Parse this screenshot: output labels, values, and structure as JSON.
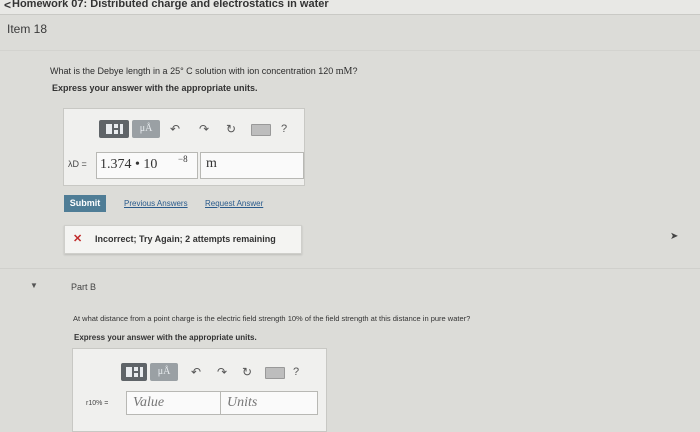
{
  "header": {
    "back_glyph": "<",
    "title": "Homework 07: Distributed charge and electrostatics in water"
  },
  "item_title": "Item 18",
  "part_a": {
    "question_prefix": "What is the Debye length in a 25° C solution with ion concentration 120 ",
    "question_unit": "mM",
    "question_suffix": "?",
    "instruction": "Express your answer with the appropriate units.",
    "toolbar": {
      "units_label": "μÅ",
      "undo_glyph": "↶",
      "redo_glyph": "↷",
      "reset_glyph": "↻",
      "help_glyph": "?"
    },
    "variable_label": "λD =",
    "answer_mantissa": "1.374 • 10",
    "answer_exponent": "−8",
    "answer_unit": "m",
    "submit_label": "Submit",
    "previous_answers_label": "Previous Answers",
    "request_answer_label": "Request Answer",
    "feedback_icon": "✕",
    "feedback_text": "Incorrect; Try Again; 2 attempts remaining"
  },
  "part_b": {
    "caret_glyph": "▼",
    "label": "Part B",
    "question": "At what distance from a point charge is the electric field strength 10% of the field strength at this distance in pure water?",
    "instruction": "Express your answer with the appropriate units.",
    "toolbar": {
      "units_label": "μÅ",
      "undo_glyph": "↶",
      "redo_glyph": "↷",
      "reset_glyph": "↻",
      "help_glyph": "?"
    },
    "variable_label": "r10% =",
    "value_placeholder": "Value",
    "units_placeholder": "Units"
  },
  "side_arrow_glyph": "➤"
}
